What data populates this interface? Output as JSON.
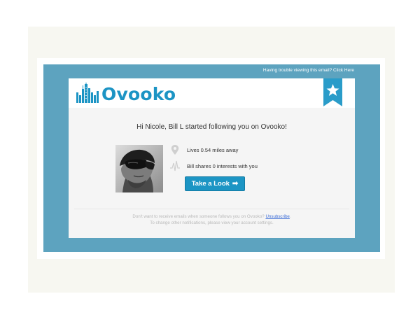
{
  "email": {
    "trouble_text": "Having trouble viewing this email?",
    "trouble_link": "Click Here",
    "brand": "Ovooko",
    "headline": "Hi Nicole, Bill L started following you on Ovooko!",
    "distance_text": "Lives 0.54 miles away",
    "interests_text": "Bill shares 0 interests with you",
    "cta_label": "Take a Look",
    "cta_arrow": "➡",
    "footer_line1_prefix": "Don't want to receive emails when someone follows you on Ovooko?",
    "unsubscribe_label": "Unsubscribe",
    "footer_line1_suffix": ".",
    "footer_line2": "To change other notifications, please view your account settings."
  },
  "colors": {
    "panel": "#5da3bf",
    "brand": "#1c94c4",
    "ribbon": "#2a9cc9",
    "link": "#3f6fd8"
  },
  "icons": [
    "skyline-logo-icon",
    "star-ribbon-icon",
    "location-pin-icon",
    "pulse-icon",
    "arrow-right-icon"
  ]
}
